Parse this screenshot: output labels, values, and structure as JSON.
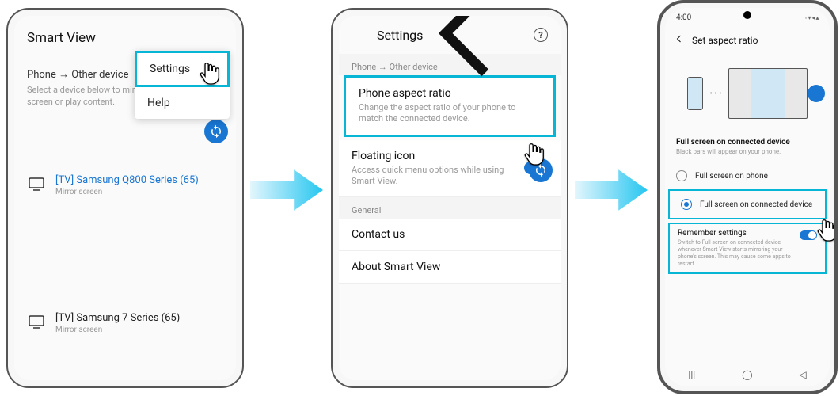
{
  "phone1": {
    "app_title": "Smart View",
    "menu": {
      "settings": "Settings",
      "help": "Help"
    },
    "section_title": "Phone → Other device",
    "section_subtitle": "Select a device below to mirror your phone's screen or play content.",
    "devices": [
      {
        "name": "[TV] Samsung Q800 Series (65)",
        "sub": "Mirror screen",
        "active": true
      },
      {
        "name": "[TV] Samsung 7 Series (65)",
        "sub": "Mirror screen",
        "active": false
      }
    ]
  },
  "phone2": {
    "header_title": "Settings",
    "section1_label": "Phone → Other device",
    "aspect": {
      "title": "Phone aspect ratio",
      "sub": "Change the aspect ratio of your phone to match the connected device."
    },
    "floating": {
      "title": "Floating icon",
      "sub": "Access quick menu options while using Smart View."
    },
    "section2_label": "General",
    "contact": "Contact us",
    "about": "About Smart View"
  },
  "phone3": {
    "status_time": "4:00",
    "header_title": "Set aspect ratio",
    "mode_title": "Full screen on connected device",
    "mode_sub": "Black bars will appear on your phone.",
    "option1": "Full screen on phone",
    "option2": "Full screen on connected device",
    "remember": {
      "title": "Remember settings",
      "sub": "Switch to Full screen on connected device whenever Smart View starts mirroring your phone's screen. This may cause some apps to restart."
    }
  }
}
